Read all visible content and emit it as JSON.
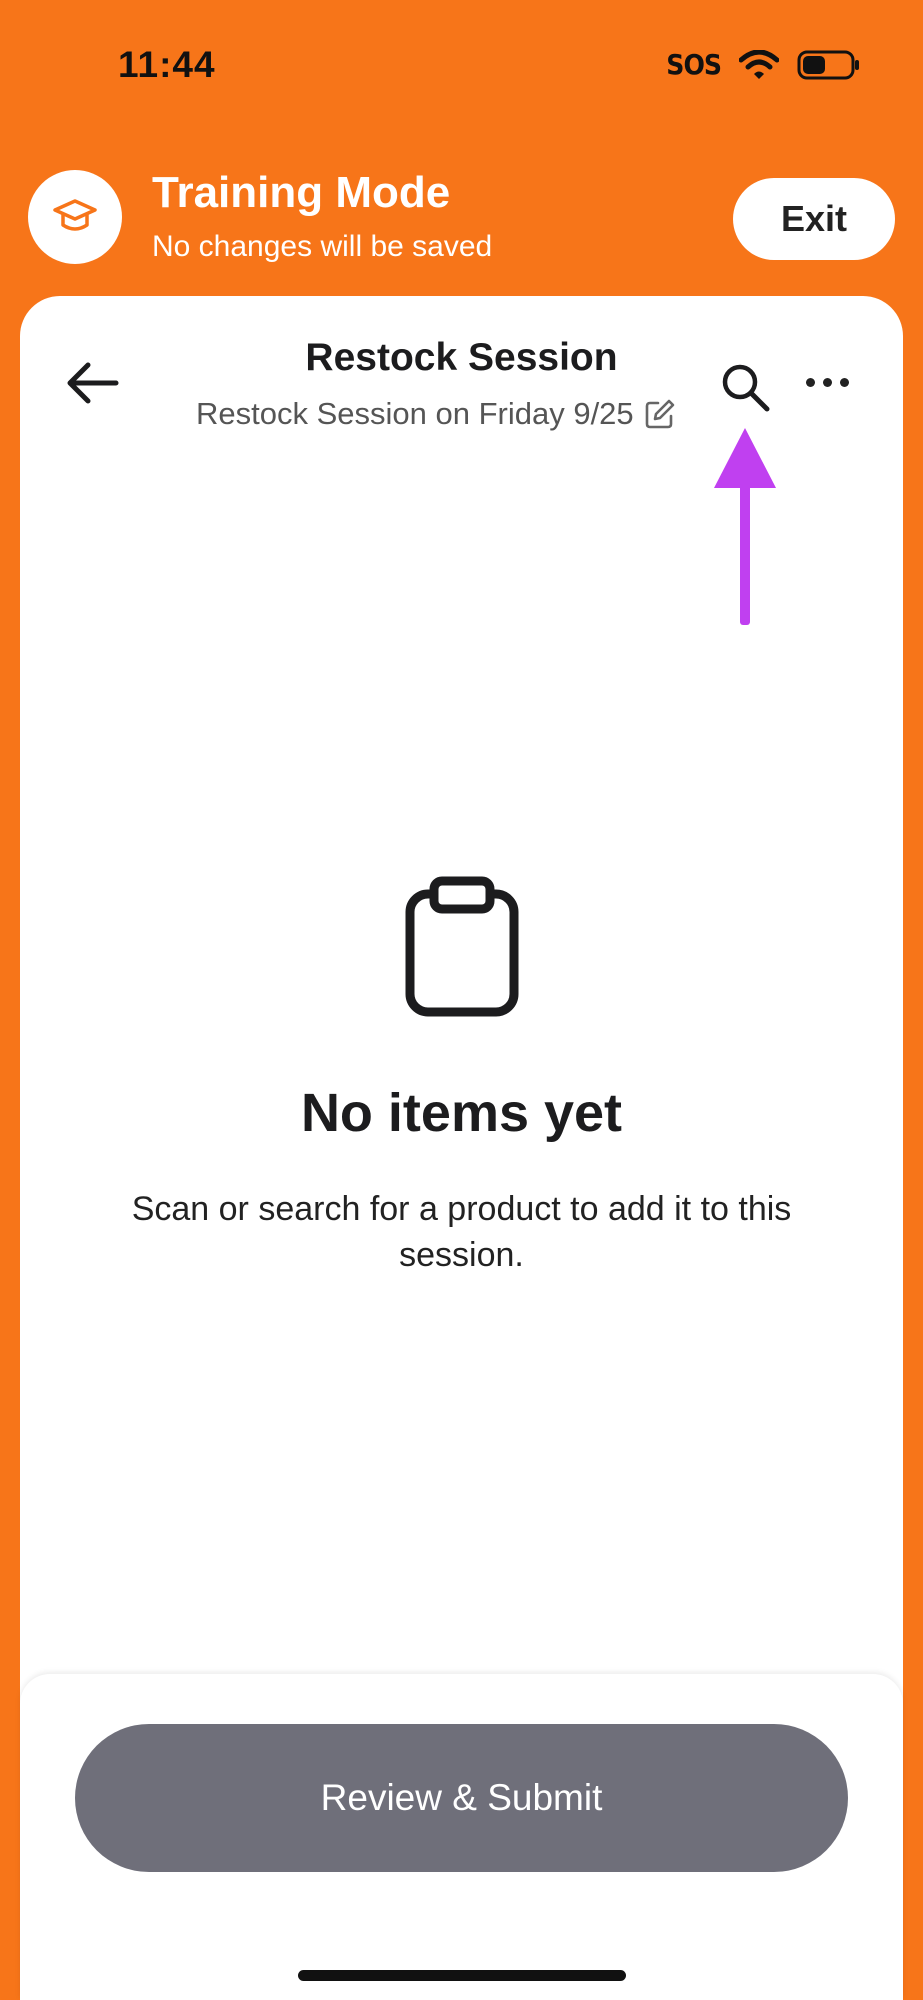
{
  "status_bar": {
    "time": "11:44",
    "carrier": "SOS"
  },
  "training_banner": {
    "title": "Training Mode",
    "subtitle": "No changes will be saved",
    "exit_label": "Exit"
  },
  "header": {
    "title": "Restock Session",
    "subtitle": "Restock Session on Friday 9/25"
  },
  "empty_state": {
    "title": "No items yet",
    "description": "Scan or search for a product to add it to this session."
  },
  "footer": {
    "submit_label": "Review & Submit"
  },
  "colors": {
    "brand_orange": "#F77519",
    "submit_disabled": "#6F6F7A",
    "annotation_arrow": "#C040F0"
  },
  "icons": [
    "graduation-cap-icon",
    "back-arrow-icon",
    "search-icon",
    "more-icon",
    "edit-icon",
    "clipboard-icon",
    "wifi-icon",
    "battery-icon"
  ]
}
